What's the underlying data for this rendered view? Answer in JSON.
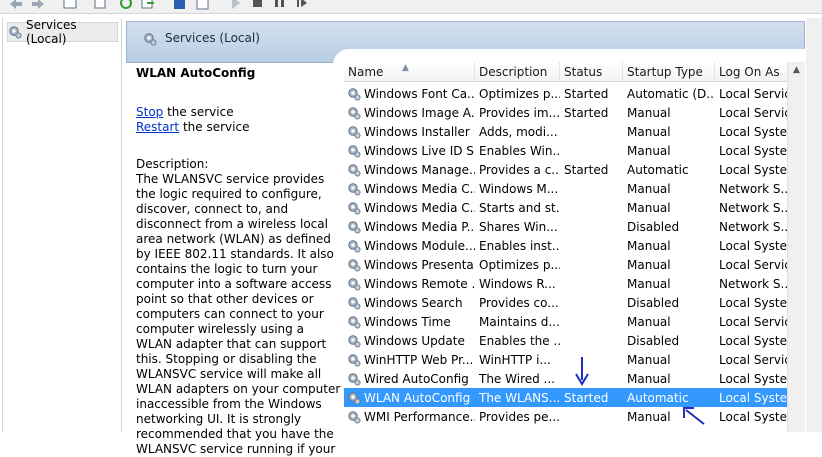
{
  "toolbar": {
    "icons": [
      "back-arrow-icon",
      "forward-arrow-icon",
      "show-tree-icon",
      "properties-icon",
      "refresh-icon",
      "export-icon",
      "help-icon",
      "console-icon",
      "play-icon",
      "stop-icon",
      "pause-icon",
      "resume-icon"
    ]
  },
  "tree": {
    "label": "Services (Local)"
  },
  "header": {
    "title": "Services (Local)"
  },
  "details": {
    "service_name": "WLAN AutoConfig",
    "stop_link": "Stop",
    "stop_rest": " the service",
    "restart_link": "Restart",
    "restart_rest": " the service",
    "description_label": "Description:",
    "description_text": "The WLANSVC service provides the logic required to configure, discover, connect to, and disconnect from a wireless local area network (WLAN) as defined by IEEE 802.11 standards. It also contains the logic to turn your computer into a software access point so that other devices or computers can connect to your computer wirelessly using a WLAN adapter that can support this. Stopping or disabling the WLANSVC service will make all WLAN adapters on your computer inaccessible from the Windows networking UI. It is strongly recommended that you have the WLANSVC service running if your"
  },
  "columns": {
    "name": "Name",
    "description": "Description",
    "status": "Status",
    "startup": "Startup Type",
    "logon": "Log On As"
  },
  "rows": [
    {
      "name": "Windows Font Ca...",
      "description": "Optimizes p...",
      "status": "Started",
      "startup": "Automatic (D...",
      "logon": "Local Service"
    },
    {
      "name": "Windows Image A...",
      "description": "Provides im...",
      "status": "Started",
      "startup": "Manual",
      "logon": "Local Service"
    },
    {
      "name": "Windows Installer",
      "description": "Adds, modi...",
      "status": "",
      "startup": "Manual",
      "logon": "Local Syste..."
    },
    {
      "name": "Windows Live ID S...",
      "description": "Enables Win...",
      "status": "",
      "startup": "Manual",
      "logon": "Local Syste..."
    },
    {
      "name": "Windows Manage...",
      "description": "Provides a c...",
      "status": "Started",
      "startup": "Automatic",
      "logon": "Local Syste..."
    },
    {
      "name": "Windows Media C...",
      "description": "Windows M...",
      "status": "",
      "startup": "Manual",
      "logon": "Network S..."
    },
    {
      "name": "Windows Media C...",
      "description": "Starts and st...",
      "status": "",
      "startup": "Manual",
      "logon": "Network S..."
    },
    {
      "name": "Windows Media P...",
      "description": "Shares Win...",
      "status": "",
      "startup": "Disabled",
      "logon": "Network S..."
    },
    {
      "name": "Windows Module...",
      "description": "Enables inst...",
      "status": "",
      "startup": "Manual",
      "logon": "Local Syste..."
    },
    {
      "name": "Windows Presenta...",
      "description": "Optimizes p...",
      "status": "",
      "startup": "Manual",
      "logon": "Local Service"
    },
    {
      "name": "Windows Remote ...",
      "description": "Windows R...",
      "status": "",
      "startup": "Manual",
      "logon": "Network S..."
    },
    {
      "name": "Windows Search",
      "description": "Provides co...",
      "status": "",
      "startup": "Disabled",
      "logon": "Local Syste..."
    },
    {
      "name": "Windows Time",
      "description": "Maintains d...",
      "status": "",
      "startup": "Manual",
      "logon": "Local Service"
    },
    {
      "name": "Windows Update",
      "description": "Enables the ...",
      "status": "",
      "startup": "Disabled",
      "logon": "Local Syste..."
    },
    {
      "name": "WinHTTP Web Pr...",
      "description": "WinHTTP i...",
      "status": "",
      "startup": "Manual",
      "logon": "Local Service"
    },
    {
      "name": "Wired AutoConfig",
      "description": "The Wired ...",
      "status": "",
      "startup": "Manual",
      "logon": "Local Syste..."
    },
    {
      "name": "WLAN AutoConfig",
      "description": "The WLANS...",
      "status": "Started",
      "startup": "Automatic",
      "logon": "Local Syste...",
      "selected": true
    },
    {
      "name": "WMI Performance...",
      "description": "Provides pe...",
      "status": "",
      "startup": "Manual",
      "logon": "Local Syste..."
    }
  ],
  "colors": {
    "selection": "#3399ff",
    "annotation_arrow": "#1f2fbf"
  }
}
